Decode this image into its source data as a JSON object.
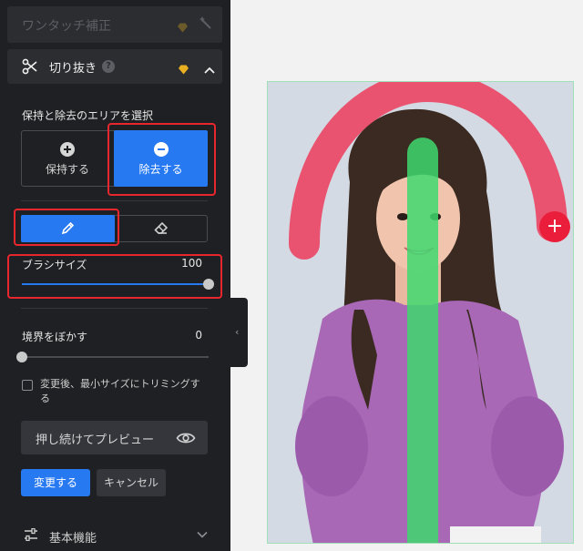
{
  "sidebar": {
    "one_touch": {
      "label": "ワンタッチ補正",
      "premium_icon": "diamond-icon",
      "tool_icon": "magic-wand-icon"
    },
    "cutout": {
      "title": "切り抜き",
      "help": "?",
      "icon": "scissors-icon",
      "select_label": "保持と除去のエリアを選択",
      "keep_label": "保持する",
      "remove_label": "除去する",
      "tools": {
        "pen": "pen-icon",
        "eraser": "eraser-icon",
        "selected": "pen"
      },
      "brush_size": {
        "label": "ブラシサイズ",
        "value": "100",
        "fraction": 1.0
      },
      "feather": {
        "label": "境界をぼかす",
        "value": "0",
        "fraction": 0.0
      },
      "trim_checkbox": {
        "label": "変更後、最小サイズにトリミングする",
        "checked": false
      },
      "preview_button": "押し続けてプレビュー",
      "apply_button": "変更する",
      "cancel_button": "キャンセル"
    },
    "basic_features": {
      "label": "基本機能"
    }
  },
  "colors": {
    "accent": "#2779f2",
    "sidebar_bg": "#1f2023",
    "panel_bg": "#2c2d31",
    "premium_gold": "#e8b021",
    "remove_stroke": "#ec4866",
    "keep_stroke": "#3fd86e",
    "highlight": "#e8262e"
  }
}
